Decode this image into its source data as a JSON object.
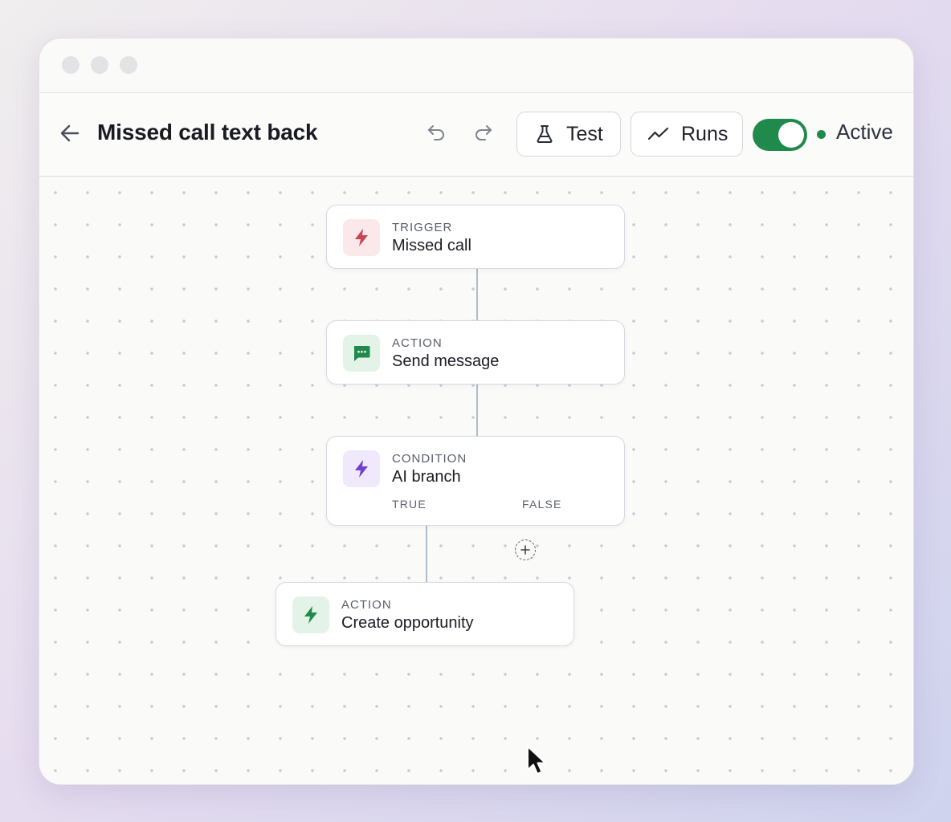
{
  "toolbar": {
    "title": "Missed call text back",
    "test_label": "Test",
    "runs_label": "Runs",
    "status_label": "Active",
    "status_color": "#1f8a4c",
    "toggle_on": true
  },
  "icons": {
    "back": "arrow-left-icon",
    "undo": "undo-icon",
    "redo": "redo-icon",
    "test": "flask-icon",
    "runs": "trend-line-icon",
    "trigger": "lightning-bolt-icon",
    "message": "chat-bubble-icon",
    "condition": "lightning-bolt-icon",
    "create": "lightning-bolt-icon",
    "add": "plus-circle-icon"
  },
  "nodes": [
    {
      "kind": "TRIGGER",
      "name": "Missed call",
      "accent": "#c9444f",
      "tint": "#fbe8ea"
    },
    {
      "kind": "ACTION",
      "name": "Send message",
      "accent": "#1f8a4c",
      "tint": "#e3f3e8"
    },
    {
      "kind": "CONDITION",
      "name": "AI branch",
      "accent": "#7040d0",
      "tint": "#efe9fb",
      "branches": [
        "TRUE",
        "FALSE"
      ]
    },
    {
      "kind": "ACTION",
      "name": "Create opportunity",
      "accent": "#1f8a4c",
      "tint": "#e3f3e8"
    }
  ]
}
